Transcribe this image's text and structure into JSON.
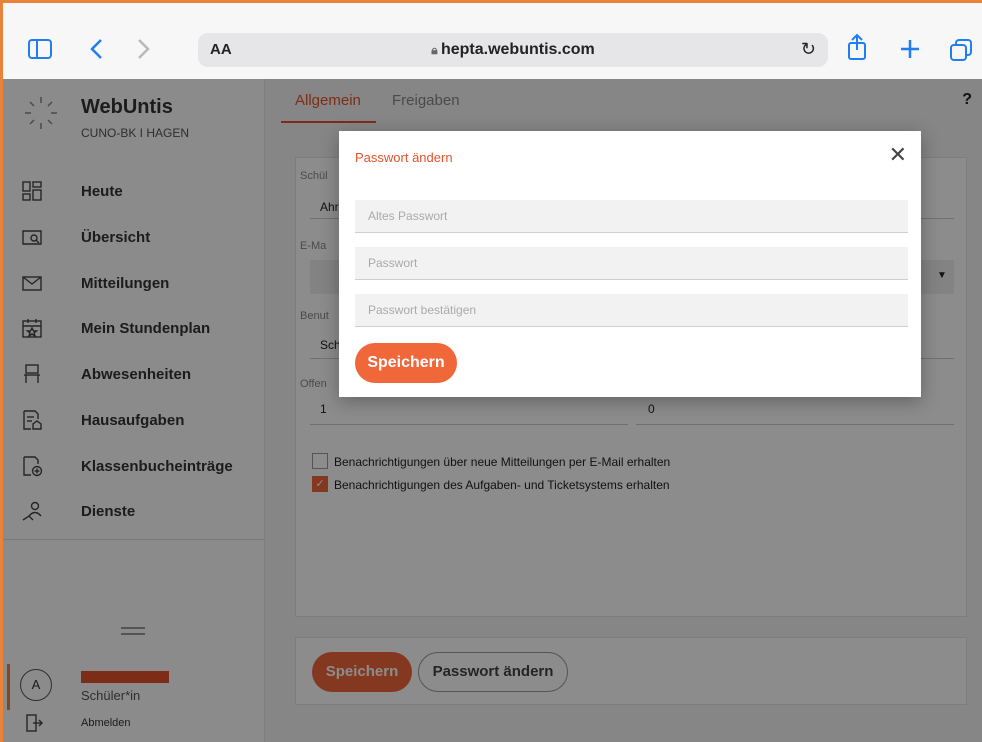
{
  "browser": {
    "text_size_label": "AA",
    "url": "hepta.webuntis.com"
  },
  "sidebar": {
    "app_title": "WebUntis",
    "school": "CUNO-BK I HAGEN",
    "items": [
      {
        "label": "Heute",
        "icon": "dashboard-icon"
      },
      {
        "label": "Übersicht",
        "icon": "overview-icon"
      },
      {
        "label": "Mitteilungen",
        "icon": "mail-icon"
      },
      {
        "label": "Mein Stundenplan",
        "icon": "calendar-icon"
      },
      {
        "label": "Abwesenheiten",
        "icon": "chair-icon"
      },
      {
        "label": "Hausaufgaben",
        "icon": "homework-icon"
      },
      {
        "label": "Klassenbucheinträge",
        "icon": "classbook-icon"
      },
      {
        "label": "Dienste",
        "icon": "duties-icon"
      }
    ],
    "user": {
      "avatar_letter": "A",
      "role": "Schüler*in",
      "logout_label": "Abmelden"
    }
  },
  "main": {
    "tabs": [
      {
        "label": "Allgemein",
        "active": true
      },
      {
        "label": "Freigaben",
        "active": false
      }
    ],
    "help_label": "?",
    "form": {
      "field1_label": "Schül",
      "field1_value": "Ahr",
      "field2_label": "E-Ma",
      "field3_label": "Benut",
      "field3_value": "Sch",
      "field4_label": "Offen",
      "field4_value_left": "1",
      "field4_value_right": "0"
    },
    "checkboxes": [
      {
        "label": "Benachrichtigungen über neue Mitteilungen per E-Mail erhalten",
        "checked": false
      },
      {
        "label": "Benachrichtigungen des Aufgaben- und Ticketsystems erhalten",
        "checked": true
      }
    ],
    "footer": {
      "save_label": "Speichern",
      "change_password_label": "Passwort ändern"
    }
  },
  "modal": {
    "title": "Passwort ändern",
    "close_label": "✕",
    "old_password_placeholder": "Altes Passwort",
    "new_password_placeholder": "Passwort",
    "confirm_password_placeholder": "Passwort bestätigen",
    "save_label": "Speichern"
  },
  "colors": {
    "accent": "#e4532b",
    "button": "#f0673a",
    "browser_border": "#e9833a",
    "ios_blue": "#1f7ff0"
  }
}
